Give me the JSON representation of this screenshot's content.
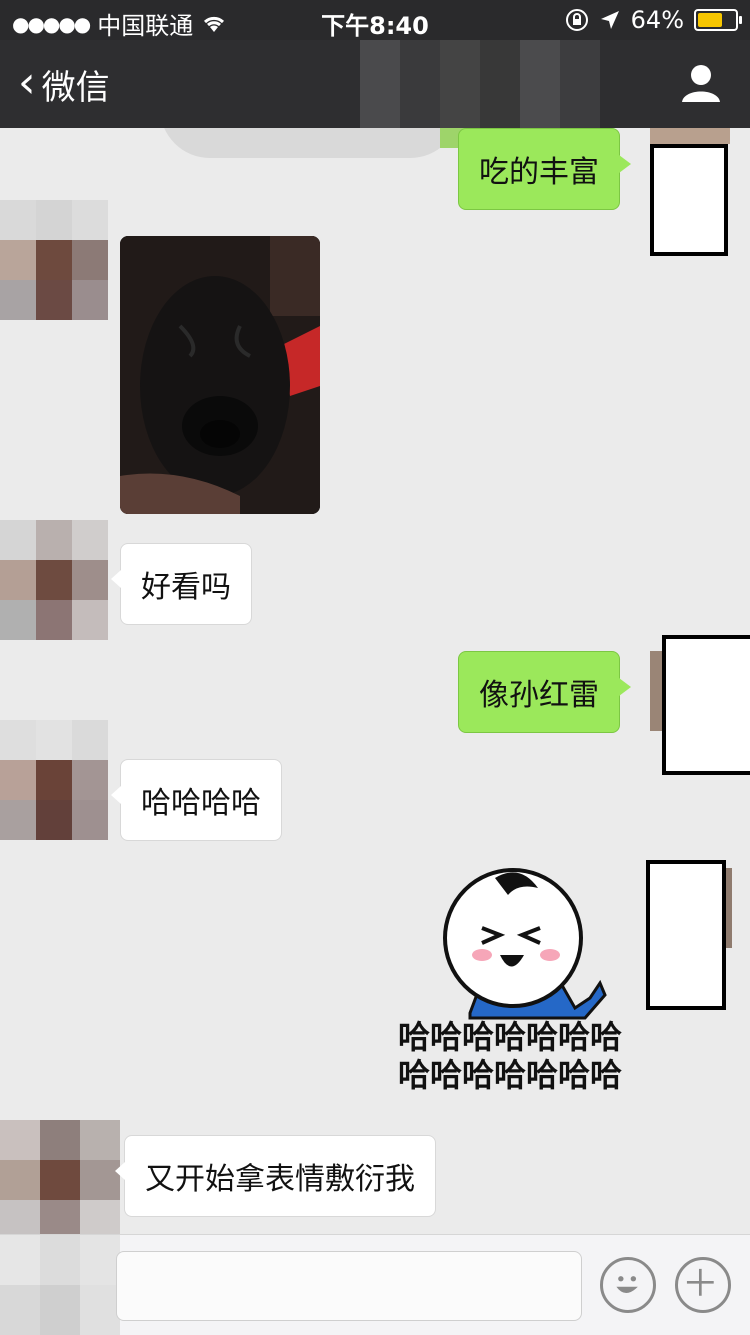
{
  "status_bar": {
    "carrier": "中国联通",
    "time": "下午8:40",
    "battery_percent": "64%"
  },
  "nav": {
    "back_label": "微信"
  },
  "messages": [
    {
      "side": "out",
      "text": "吃的丰富"
    },
    {
      "side": "in",
      "type": "image",
      "description_icon": "dog-photo"
    },
    {
      "side": "in",
      "text": "好看吗"
    },
    {
      "side": "out",
      "text": "像孙红雷"
    },
    {
      "side": "in",
      "text": "哈哈哈哈"
    },
    {
      "side": "out",
      "type": "sticker",
      "text_line1": "哈哈哈哈哈哈哈",
      "text_line2": "哈哈哈哈哈哈哈"
    },
    {
      "side": "in",
      "text": "又开始拿表情敷衍我"
    }
  ],
  "colors": {
    "nav_bg": "#2e2e30",
    "outgoing_bubble": "#9be85b",
    "incoming_bubble": "#ffffff",
    "battery": "#f7c600"
  }
}
